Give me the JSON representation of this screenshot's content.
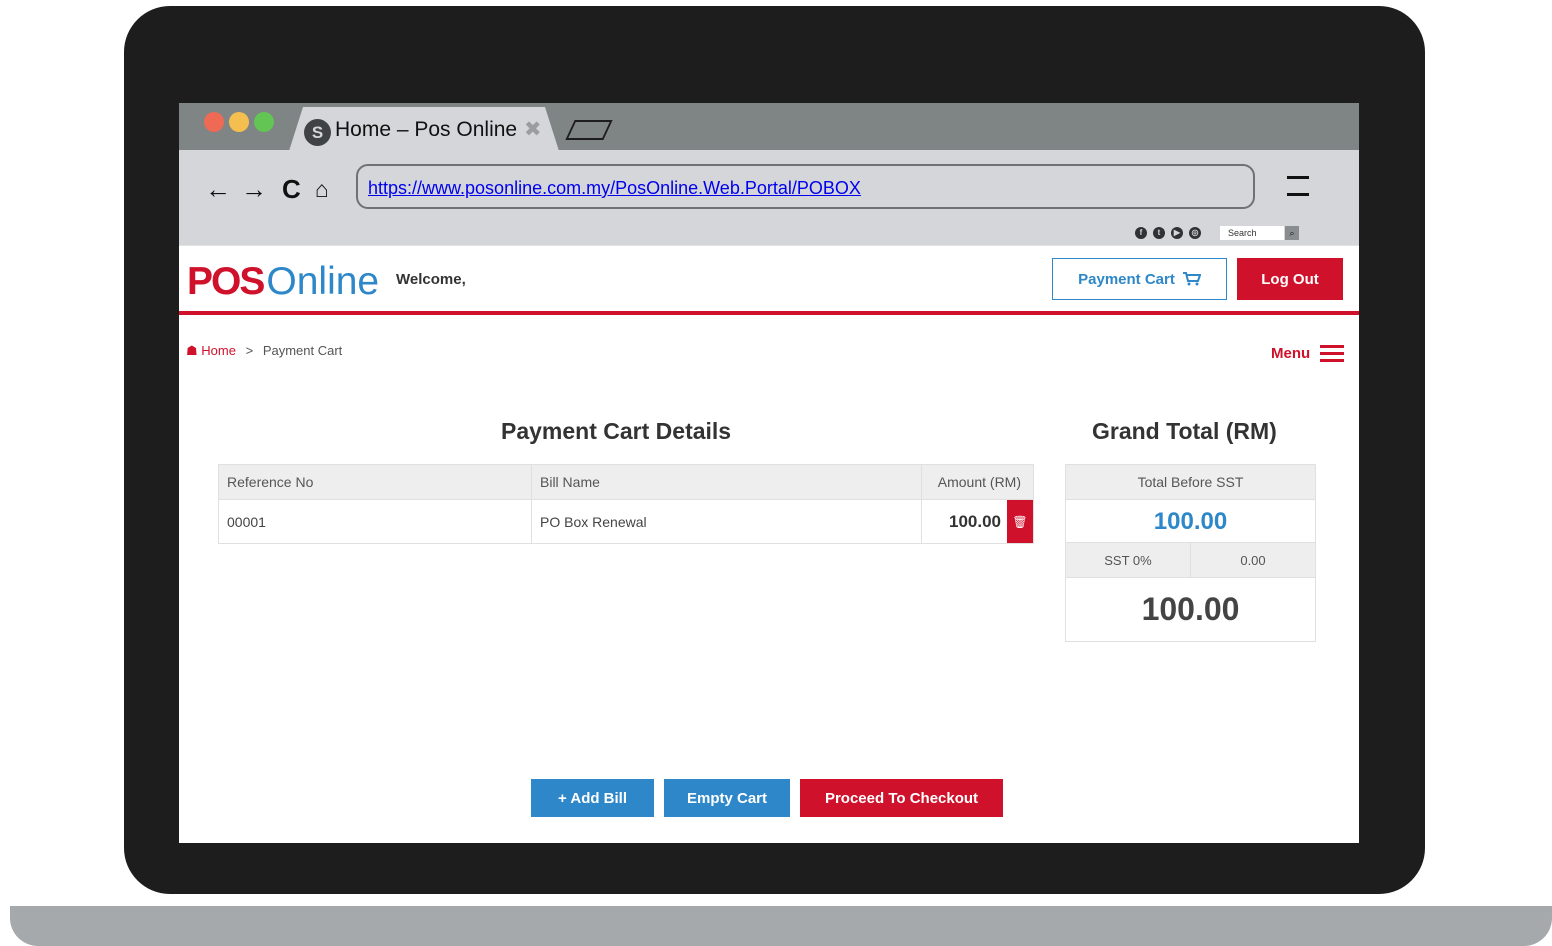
{
  "browser": {
    "tab_title": "Home – Pos Online",
    "tab_close": "✖",
    "url": "https://www.posonline.com.my/PosOnline.Web.Portal/POBOX",
    "search_placeholder": "Search",
    "social_icons": [
      "facebook-icon",
      "twitter-icon",
      "youtube-icon",
      "instagram-icon"
    ]
  },
  "header": {
    "logo_pos": "POS",
    "logo_online": "Online",
    "welcome": "Welcome,",
    "payment_cart_label": "Payment Cart",
    "logout_label": "Log Out"
  },
  "breadcrumb": {
    "home": "Home",
    "separator": ">",
    "current": "Payment Cart"
  },
  "menu_label": "Menu",
  "cart": {
    "title": "Payment Cart Details",
    "columns": [
      "Reference No",
      "Bill Name",
      "Amount (RM)"
    ],
    "rows": [
      {
        "reference": "00001",
        "bill_name": "PO Box Renewal",
        "amount": "100.00"
      }
    ]
  },
  "totals": {
    "title": "Grand Total (RM)",
    "before_label": "Total Before SST",
    "before_value": "100.00",
    "sst_label": "SST 0%",
    "sst_value": "0.00",
    "grand_value": "100.00"
  },
  "actions": {
    "add_bill": "+ Add Bill",
    "empty_cart": "Empty Cart",
    "checkout": "Proceed To Checkout"
  },
  "colors": {
    "brand_red": "#d0112b",
    "brand_blue": "#2d87c8"
  }
}
